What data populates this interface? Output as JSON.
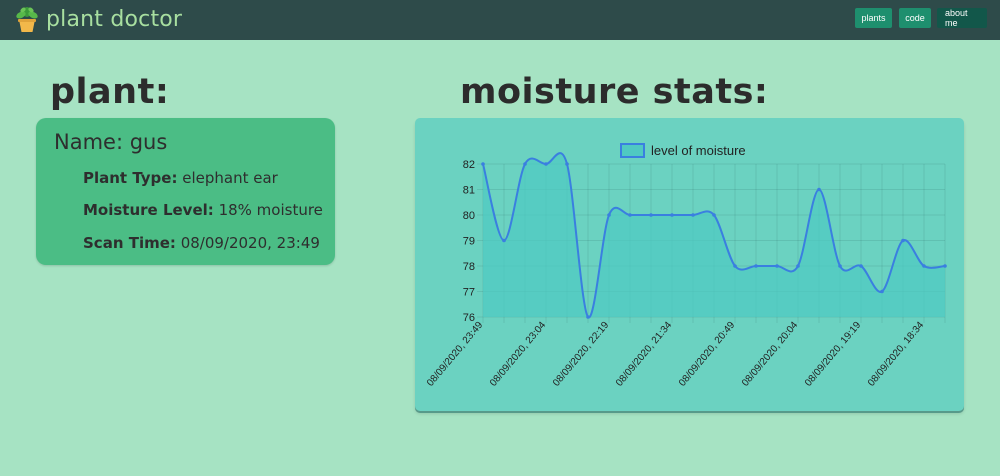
{
  "app": {
    "title": "plant doctor",
    "logo_icon": "potted-plant-icon"
  },
  "nav": {
    "plants_label": "plants",
    "code_label": "code",
    "about_label": "about me"
  },
  "plant_section": {
    "heading": "plant:",
    "name_label": "Name:",
    "name_value": "gus",
    "type_label": "Plant Type:",
    "type_value": "elephant ear",
    "moisture_label": "Moisture Level:",
    "moisture_value": "18% moisture",
    "scan_label": "Scan Time:",
    "scan_value": "08/09/2020, 23:49"
  },
  "stats_section": {
    "heading": "moisture stats:"
  },
  "colors": {
    "background": "#a6e3c3",
    "navbar": "#2e4b4a",
    "brand_text": "#a8dfa0",
    "card": "#4bbd85",
    "chart_panel": "#6bd2c1",
    "line": "#3a7fe0",
    "fill": "#4fc9c2"
  },
  "chart_data": {
    "type": "line",
    "legend": "level of moisture",
    "legend_position": "top",
    "grid": true,
    "curve": "smooth",
    "ylim": [
      76,
      82
    ],
    "yticks": [
      76,
      77,
      78,
      79,
      80,
      81,
      82
    ],
    "x_tick_labels": [
      "08/09/2020, 23:49",
      "08/09/2020, 23:04",
      "08/09/2020, 22:19",
      "08/09/2020, 21:34",
      "08/09/2020, 20:49",
      "08/09/2020, 20:04",
      "08/09/2020, 19:19",
      "08/09/2020, 18:34"
    ],
    "values": [
      82,
      79,
      82,
      82,
      82,
      76,
      80,
      80,
      80,
      80,
      80,
      80,
      78,
      78,
      78,
      78,
      81,
      78,
      78,
      77,
      79,
      78,
      78
    ]
  }
}
